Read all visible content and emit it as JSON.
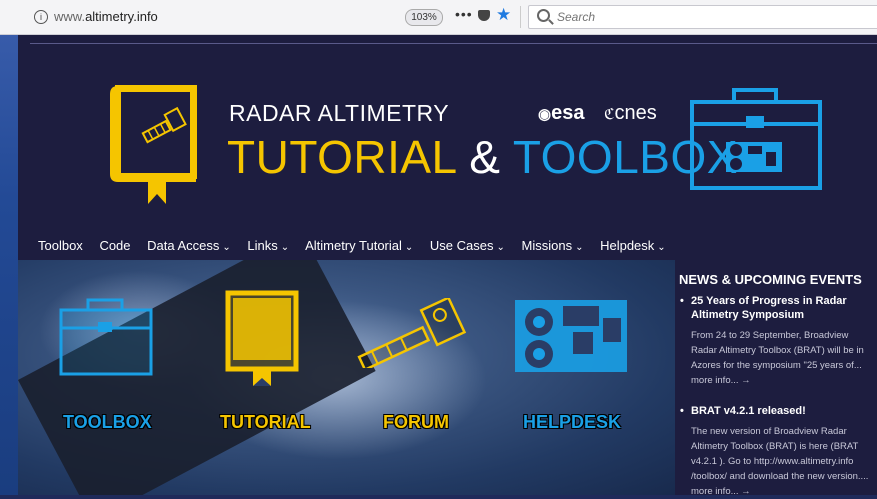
{
  "browser": {
    "url_prefix": "www.",
    "url_host": "altimetry.info",
    "zoom": "103%",
    "menu": "•••",
    "search_placeholder": "Search",
    "info": "i"
  },
  "header": {
    "subtitle": "RADAR ALTIMETRY",
    "title_part1": "TUTORIAL",
    "title_amp": " & ",
    "title_part2": "TOOLBOX",
    "logo_esa": "esa",
    "logo_cnes": "cnes"
  },
  "nav": {
    "items": [
      "Toolbox",
      "Code",
      "Data Access",
      "Links",
      "Altimetry Tutorial",
      "Use Cases",
      "Missions",
      "Helpdesk"
    ],
    "chevron": "⌄"
  },
  "hero": {
    "toolbox": "TOOLBOX",
    "tutorial": "TUTORIAL",
    "forum": "FORUM",
    "helpdesk": "HELPDESK"
  },
  "sidebar": {
    "heading": "NEWS & UPCOMING EVENTS",
    "news": [
      {
        "title": "25 Years of Progress in Radar Altimetry Symposium",
        "body": "From 24 to 29 September, Broadview Radar Altimetry Toolbox (BRAT) will be in Azores for the symposium \"25 years of... more info... →"
      },
      {
        "title": "BRAT v4.2.1 released!",
        "body": "The new version of Broadview Radar Altimetry Toolbox (BRAT) is here (BRAT v4.2.1 ). Go to http://www.altimetry.info /toolbox/ and download the new version.... more info... →"
      }
    ]
  },
  "colors": {
    "yellow": "#f5c500",
    "blue": "#1aa0e6",
    "background": "#1d1d3f"
  }
}
